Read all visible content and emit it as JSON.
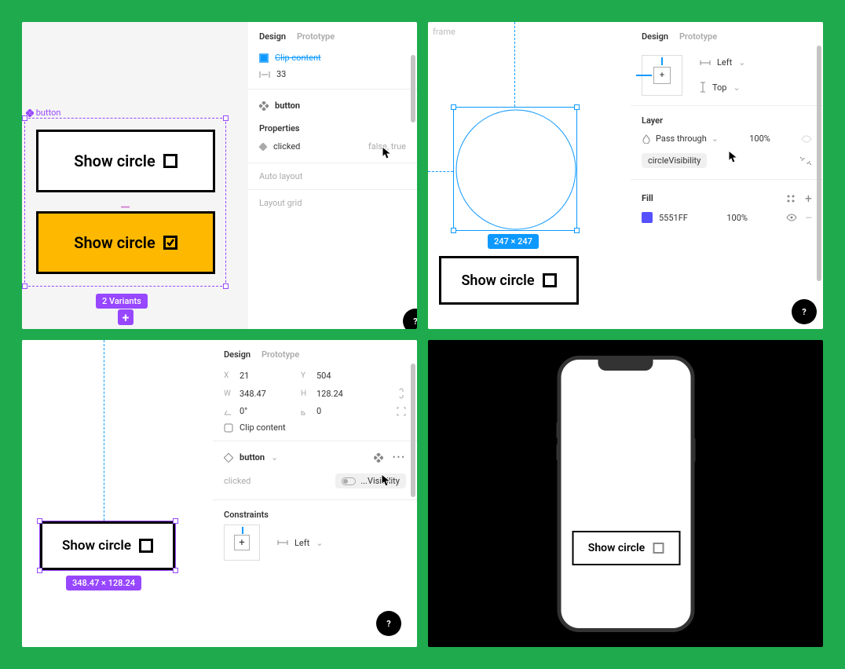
{
  "tabs": {
    "design": "Design",
    "prototype": "Prototype"
  },
  "p1": {
    "frame_label": "button",
    "btn_text": "Show circle",
    "variants_badge": "2 Variants",
    "clip_row": "Clip content",
    "gap": "33",
    "comp_name": "button",
    "props_title": "Properties",
    "prop_name": "clicked",
    "prop_values": "false, true",
    "autolayout": "Auto layout",
    "layoutgrid": "Layout grid"
  },
  "p2": {
    "frame_label": "frame",
    "sel_size": "247 × 247",
    "btn_text": "Show circle",
    "h_left": "Left",
    "v_top": "Top",
    "layer": "Layer",
    "blend": "Pass through",
    "opacity": "100%",
    "variable": "circleVisibility",
    "fill": "Fill",
    "fill_hex": "5551FF",
    "fill_op": "100%",
    "fill_color": "#5551FF"
  },
  "p3": {
    "x": "21",
    "y": "504",
    "w": "348.47",
    "h": "128.24",
    "rot": "0°",
    "rad": "0",
    "clip": "Clip content",
    "comp": "button",
    "prop_name": "clicked",
    "prop_val": "...Visibility",
    "constraints": "Constraints",
    "h_left": "Left",
    "sel_badge": "348.47 × 128.24",
    "btn_text": "Show circle"
  },
  "p4": {
    "btn_text": "Show circle"
  }
}
